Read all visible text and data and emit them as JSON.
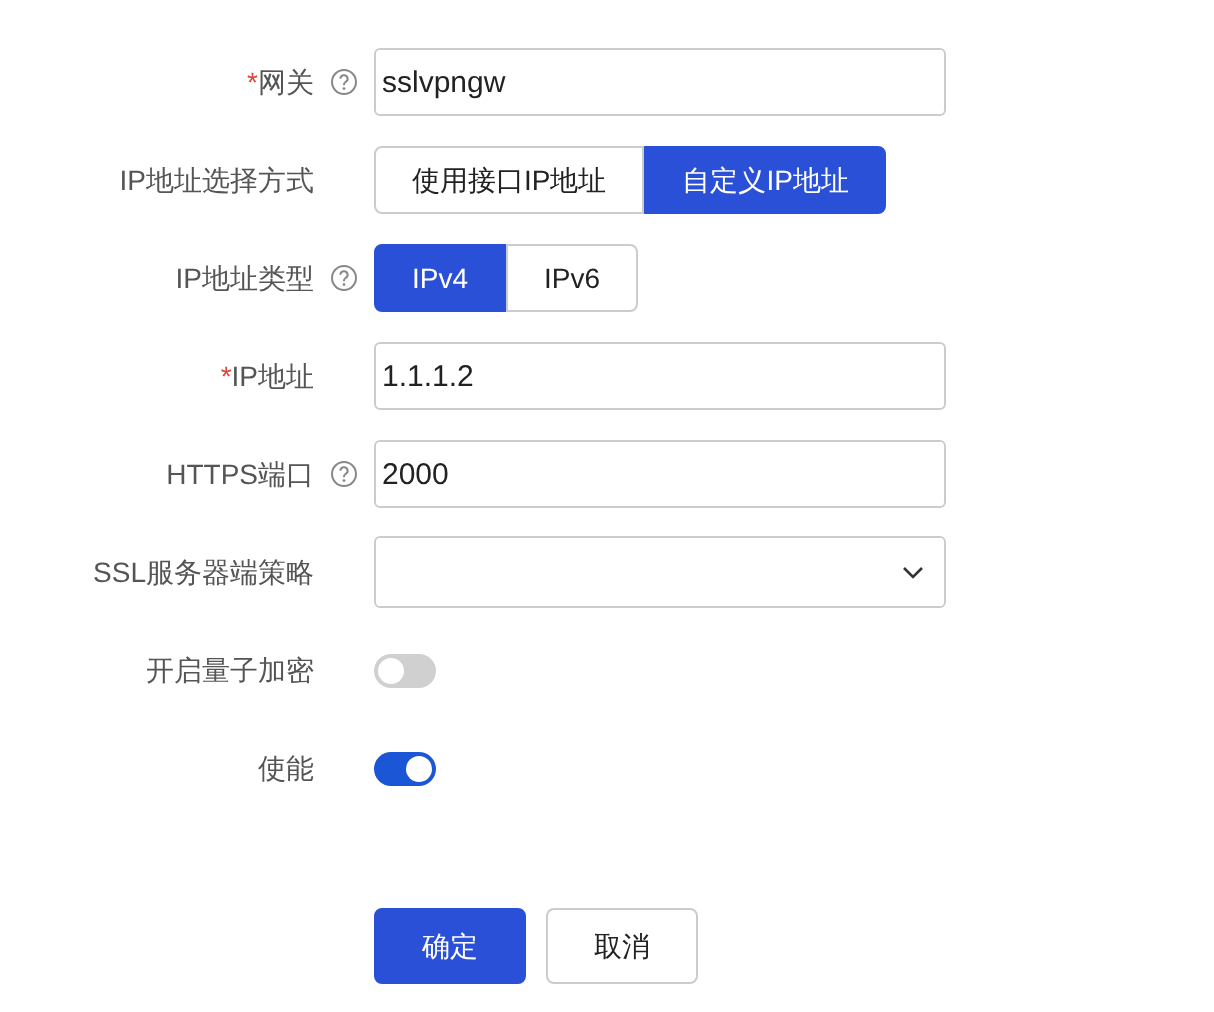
{
  "form": {
    "rows": [
      {
        "kind": "input",
        "mark": "*",
        "label": "网关",
        "help": true,
        "value": "sslvpngw"
      },
      {
        "kind": "segmented",
        "label": "IP地址选择方式",
        "help": false,
        "options": [
          {
            "label": "使用接口IP地址",
            "selected": false
          },
          {
            "label": "自定义IP地址",
            "selected": true
          }
        ]
      },
      {
        "kind": "segmented",
        "label": "IP地址类型",
        "help": true,
        "options": [
          {
            "label": "IPv4",
            "selected": true
          },
          {
            "label": "IPv6",
            "selected": false
          }
        ]
      },
      {
        "kind": "input",
        "mark": "*",
        "label": "IP地址",
        "help": false,
        "value": "1.1.1.2"
      },
      {
        "kind": "input",
        "label": "HTTPS端口",
        "help": true,
        "value": "2000"
      },
      {
        "kind": "select",
        "label": "SSL服务器端策略",
        "help": false
      },
      {
        "kind": "toggle",
        "label": "开启量子加密",
        "help": false,
        "on": false
      },
      {
        "kind": "toggle",
        "label": "使能",
        "help": false,
        "on": true
      }
    ]
  },
  "buttons": [
    {
      "label": "确定",
      "kind": "primary"
    },
    {
      "label": "取消",
      "kind": "secondary"
    }
  ]
}
